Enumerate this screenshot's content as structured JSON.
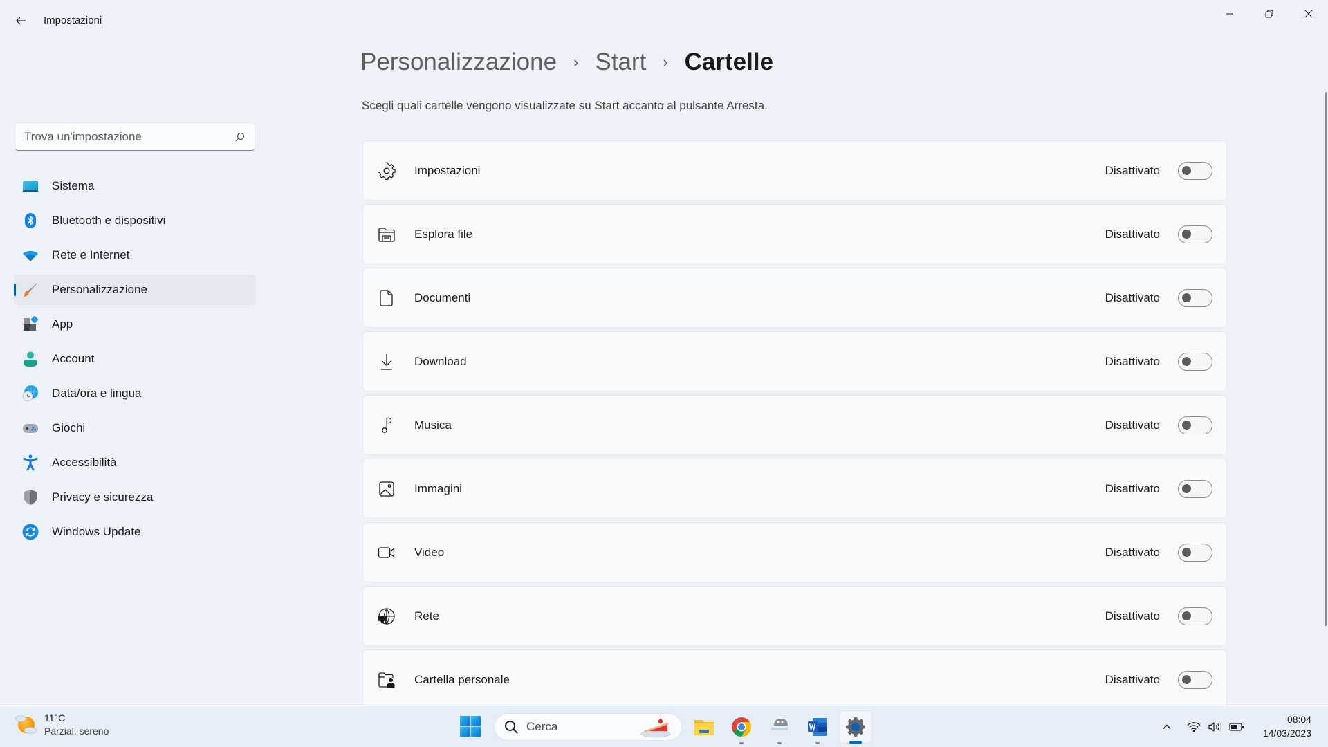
{
  "window": {
    "app_title": "Impostazioni",
    "controls": {
      "minimize": "minimize",
      "maximize": "restore",
      "close": "close"
    }
  },
  "sidebar": {
    "search": {
      "placeholder": "Trova un'impostazione",
      "value": ""
    },
    "items": [
      {
        "label": "Sistema",
        "icon": "system-icon",
        "selected": false
      },
      {
        "label": "Bluetooth e dispositivi",
        "icon": "bluetooth-icon",
        "selected": false
      },
      {
        "label": "Rete e Internet",
        "icon": "wifi-icon",
        "selected": false
      },
      {
        "label": "Personalizzazione",
        "icon": "paintbrush-icon",
        "selected": true
      },
      {
        "label": "App",
        "icon": "apps-icon",
        "selected": false
      },
      {
        "label": "Account",
        "icon": "account-icon",
        "selected": false
      },
      {
        "label": "Data/ora e lingua",
        "icon": "time-language-icon",
        "selected": false
      },
      {
        "label": "Giochi",
        "icon": "gamepad-icon",
        "selected": false
      },
      {
        "label": "Accessibilità",
        "icon": "accessibility-icon",
        "selected": false
      },
      {
        "label": "Privacy e sicurezza",
        "icon": "shield-icon",
        "selected": false
      },
      {
        "label": "Windows Update",
        "icon": "windows-update-icon",
        "selected": false
      }
    ]
  },
  "main": {
    "breadcrumb": [
      "Personalizzazione",
      "Start",
      "Cartelle"
    ],
    "subtitle": "Scegli quali cartelle vengono visualizzate su Start accanto al pulsante Arresta.",
    "folders": [
      {
        "label": "Impostazioni",
        "icon": "gear-icon",
        "state": "Disattivato",
        "on": false
      },
      {
        "label": "Esplora file",
        "icon": "file-explorer-icon",
        "state": "Disattivato",
        "on": false
      },
      {
        "label": "Documenti",
        "icon": "document-icon",
        "state": "Disattivato",
        "on": false
      },
      {
        "label": "Download",
        "icon": "download-icon",
        "state": "Disattivato",
        "on": false
      },
      {
        "label": "Musica",
        "icon": "music-note-icon",
        "state": "Disattivato",
        "on": false
      },
      {
        "label": "Immagini",
        "icon": "image-icon",
        "state": "Disattivato",
        "on": false
      },
      {
        "label": "Video",
        "icon": "video-camera-icon",
        "state": "Disattivato",
        "on": false
      },
      {
        "label": "Rete",
        "icon": "network-globe-icon",
        "state": "Disattivato",
        "on": false
      },
      {
        "label": "Cartella personale",
        "icon": "personal-folder-icon",
        "state": "Disattivato",
        "on": false
      }
    ]
  },
  "taskbar": {
    "weather": {
      "temperature": "11°C",
      "description": "Parzial. sereno"
    },
    "search_label": "Cerca",
    "apps": [
      {
        "name": "File Explorer",
        "icon": "file-explorer-icon",
        "running": false,
        "active": false
      },
      {
        "name": "Google Chrome",
        "icon": "chrome-icon",
        "running": true,
        "active": false
      },
      {
        "name": "GIMP",
        "icon": "gimp-icon",
        "running": true,
        "active": false
      },
      {
        "name": "Word",
        "icon": "word-icon",
        "running": true,
        "active": false
      },
      {
        "name": "Impostazioni",
        "icon": "settings-icon",
        "running": true,
        "active": true
      }
    ],
    "time": "08:04",
    "date": "14/03/2023"
  },
  "colors": {
    "accent": "#0067c0",
    "background": "#eff3f9",
    "card": "#f9fafc",
    "toggle_knob_off": "#5c5c5c"
  }
}
